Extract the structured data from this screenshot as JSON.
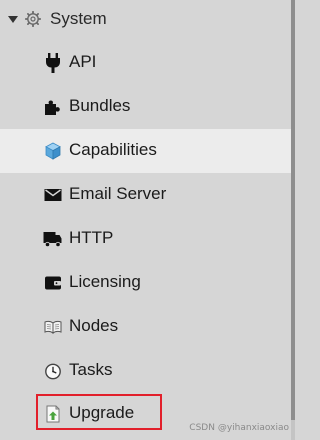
{
  "section": {
    "label": "System",
    "icon": "gear-icon"
  },
  "items": [
    {
      "label": "API",
      "icon": "plug-icon",
      "selected": false
    },
    {
      "label": "Bundles",
      "icon": "puzzle-icon",
      "selected": false
    },
    {
      "label": "Capabilities",
      "icon": "cube-icon",
      "selected": true
    },
    {
      "label": "Email Server",
      "icon": "envelope-icon",
      "selected": false
    },
    {
      "label": "HTTP",
      "icon": "truck-icon",
      "selected": false
    },
    {
      "label": "Licensing",
      "icon": "wallet-icon",
      "selected": false
    },
    {
      "label": "Nodes",
      "icon": "book-icon",
      "selected": false
    },
    {
      "label": "Tasks",
      "icon": "clock-icon",
      "selected": false
    },
    {
      "label": "Upgrade",
      "icon": "upgrade-icon",
      "selected": false
    }
  ],
  "watermark": "CSDN @yihanxiaoxiao",
  "colors": {
    "highlight": "#e2202b",
    "selected_bg": "#ececec",
    "panel_bg": "#d6d6d6",
    "cube": "#5aa8dc"
  }
}
